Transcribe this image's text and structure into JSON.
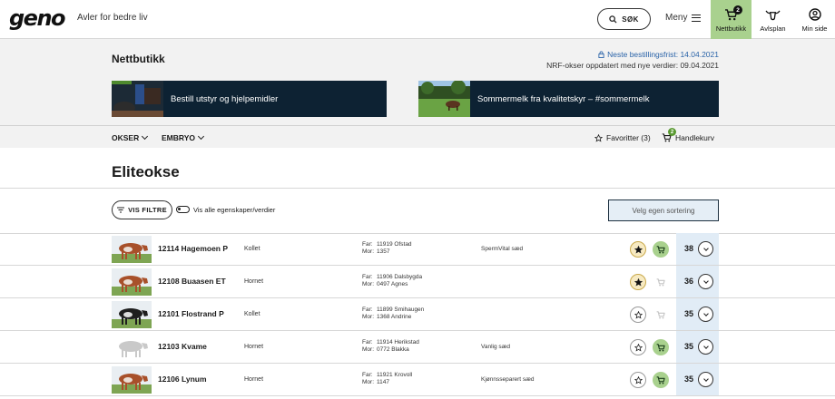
{
  "header": {
    "logo": "geno",
    "tagline": "Avler for bedre liv",
    "search_label": "SØK",
    "menu_label": "Meny",
    "nav": [
      {
        "label": "Nettbutikk",
        "badge": "2",
        "active": true
      },
      {
        "label": "Avlsplan",
        "active": false
      },
      {
        "label": "Min side",
        "active": false
      }
    ]
  },
  "hero": {
    "title": "Nettbutikk",
    "deadline": "Neste bestillingsfrist: 14.04.2021",
    "update": "NRF-okser oppdatert med nye verdier: 09.04.2021",
    "banners": [
      {
        "text": "Bestill utstyr og hjelpemidler"
      },
      {
        "text": "Sommermelk fra kvalitetskyr – #sommermelk"
      }
    ]
  },
  "subnav": {
    "okser": "OKSER",
    "embryo": "EMBRYO",
    "favorites": "Favoritter (3)",
    "cart": "Handlekurv",
    "cart_count": "2"
  },
  "page": {
    "title": "Eliteokse",
    "filter_label": "VIS FILTRE",
    "toggle_label": "Vis alle egenskaper/verdier",
    "sort_label": "Velg egen sortering"
  },
  "rows": [
    {
      "name": "12114 Hagemoen P",
      "horn": "Kollet",
      "far_label": "Far:",
      "far": "11919 Ofstad",
      "mor_label": "Mor:",
      "mor": "1357",
      "semen": "SpermVital sæd",
      "favorite": true,
      "in_cart": true,
      "score": "38",
      "coat": "red"
    },
    {
      "name": "12108 Buaasen ET",
      "horn": "Hornet",
      "far_label": "Far:",
      "far": "11906 Dalsbygda",
      "mor_label": "Mor:",
      "mor": "0497 Agnes",
      "semen": "",
      "favorite": true,
      "in_cart": false,
      "score": "36",
      "coat": "red"
    },
    {
      "name": "12101 Flostrand P",
      "horn": "Kollet",
      "far_label": "Far:",
      "far": "11899 Smihaugen",
      "mor_label": "Mor:",
      "mor": "1368 Andrine",
      "semen": "",
      "favorite": false,
      "in_cart": false,
      "score": "35",
      "coat": "black"
    },
    {
      "name": "12103 Kvame",
      "horn": "Hornet",
      "far_label": "Far:",
      "far": "11914 Herikstad",
      "mor_label": "Mor:",
      "mor": "0772 Blakka",
      "semen": "Vanlig sæd",
      "favorite": false,
      "in_cart": true,
      "score": "35",
      "coat": "grey"
    },
    {
      "name": "12106 Lynum",
      "horn": "Hornet",
      "far_label": "Far:",
      "far": "11921 Krovoll",
      "mor_label": "Mor:",
      "mor": "1147",
      "semen": "Kjønnsseparert sæd",
      "favorite": false,
      "in_cart": true,
      "score": "35",
      "coat": "red"
    }
  ],
  "colors": {
    "accent_green": "#a9d18e",
    "banner_navy": "#0d2233",
    "link_blue": "#2a63a8",
    "score_bg": "#e1ecf6"
  }
}
